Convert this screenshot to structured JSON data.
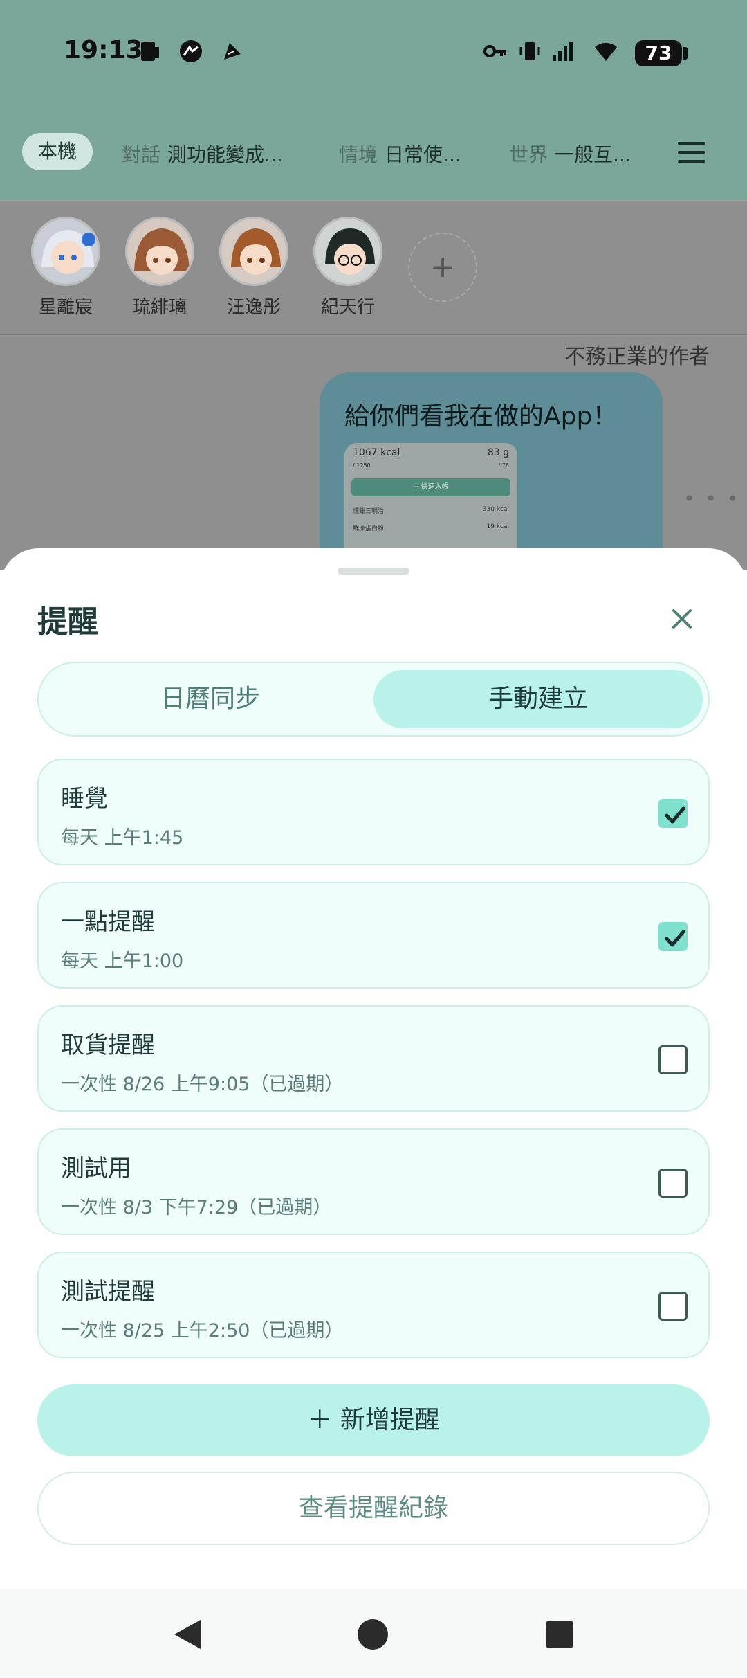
{
  "status_bar": {
    "time": "19:13",
    "battery": "73"
  },
  "top_tabs": {
    "local": "本機",
    "conversation": {
      "key": "對話",
      "value": "測功能變成..."
    },
    "scenario": {
      "key": "情境",
      "value": "日常使..."
    },
    "world": {
      "key": "世界",
      "value": "一般互..."
    }
  },
  "characters": [
    {
      "name": "星離宸",
      "hair": "#e6e9ef",
      "accent": "#2f6fd1"
    },
    {
      "name": "琉緋璃",
      "hair": "#9a5a35",
      "accent": "#7a3d1e"
    },
    {
      "name": "汪逸彤",
      "hair": "#a35b2c",
      "accent": "#6e3a17"
    },
    {
      "name": "紀天行",
      "hair": "#1f2a26",
      "accent": "#0d1311"
    }
  ],
  "chat": {
    "author": "不務正業的作者",
    "message": "給你們看我在做的App！",
    "preview": {
      "kcal": "1067 kcal",
      "kcal_sub": "/ 1250",
      "grams": "83 g",
      "grams_sub": "/ 76",
      "quick_add": "+ 快速入帳",
      "row1_name": "燻雞三明治",
      "row1_value": "330 kcal",
      "row2_name": "鮮原蛋白粉",
      "row2_value": "19 kcal"
    }
  },
  "sheet": {
    "title": "提醒",
    "segments": {
      "calendar": "日曆同步",
      "manual": "手動建立"
    },
    "reminders": [
      {
        "title": "睡覺",
        "subtitle": "每天 上午1:45",
        "checked": true
      },
      {
        "title": "一點提醒",
        "subtitle": "每天 上午1:00",
        "checked": true
      },
      {
        "title": "取貨提醒",
        "subtitle": "一次性 8/26 上午9:05（已過期）",
        "checked": false
      },
      {
        "title": "測試用",
        "subtitle": "一次性 8/3 下午7:29（已過期）",
        "checked": false
      },
      {
        "title": "測試提醒",
        "subtitle": "一次性 8/25 上午2:50（已過期）",
        "checked": false
      }
    ],
    "add_button": "＋ 新增提醒",
    "log_button": "查看提醒紀錄"
  },
  "colors": {
    "accent": "#b9f2e8",
    "check": "#7fe0cd",
    "header": "#7aa69c"
  }
}
